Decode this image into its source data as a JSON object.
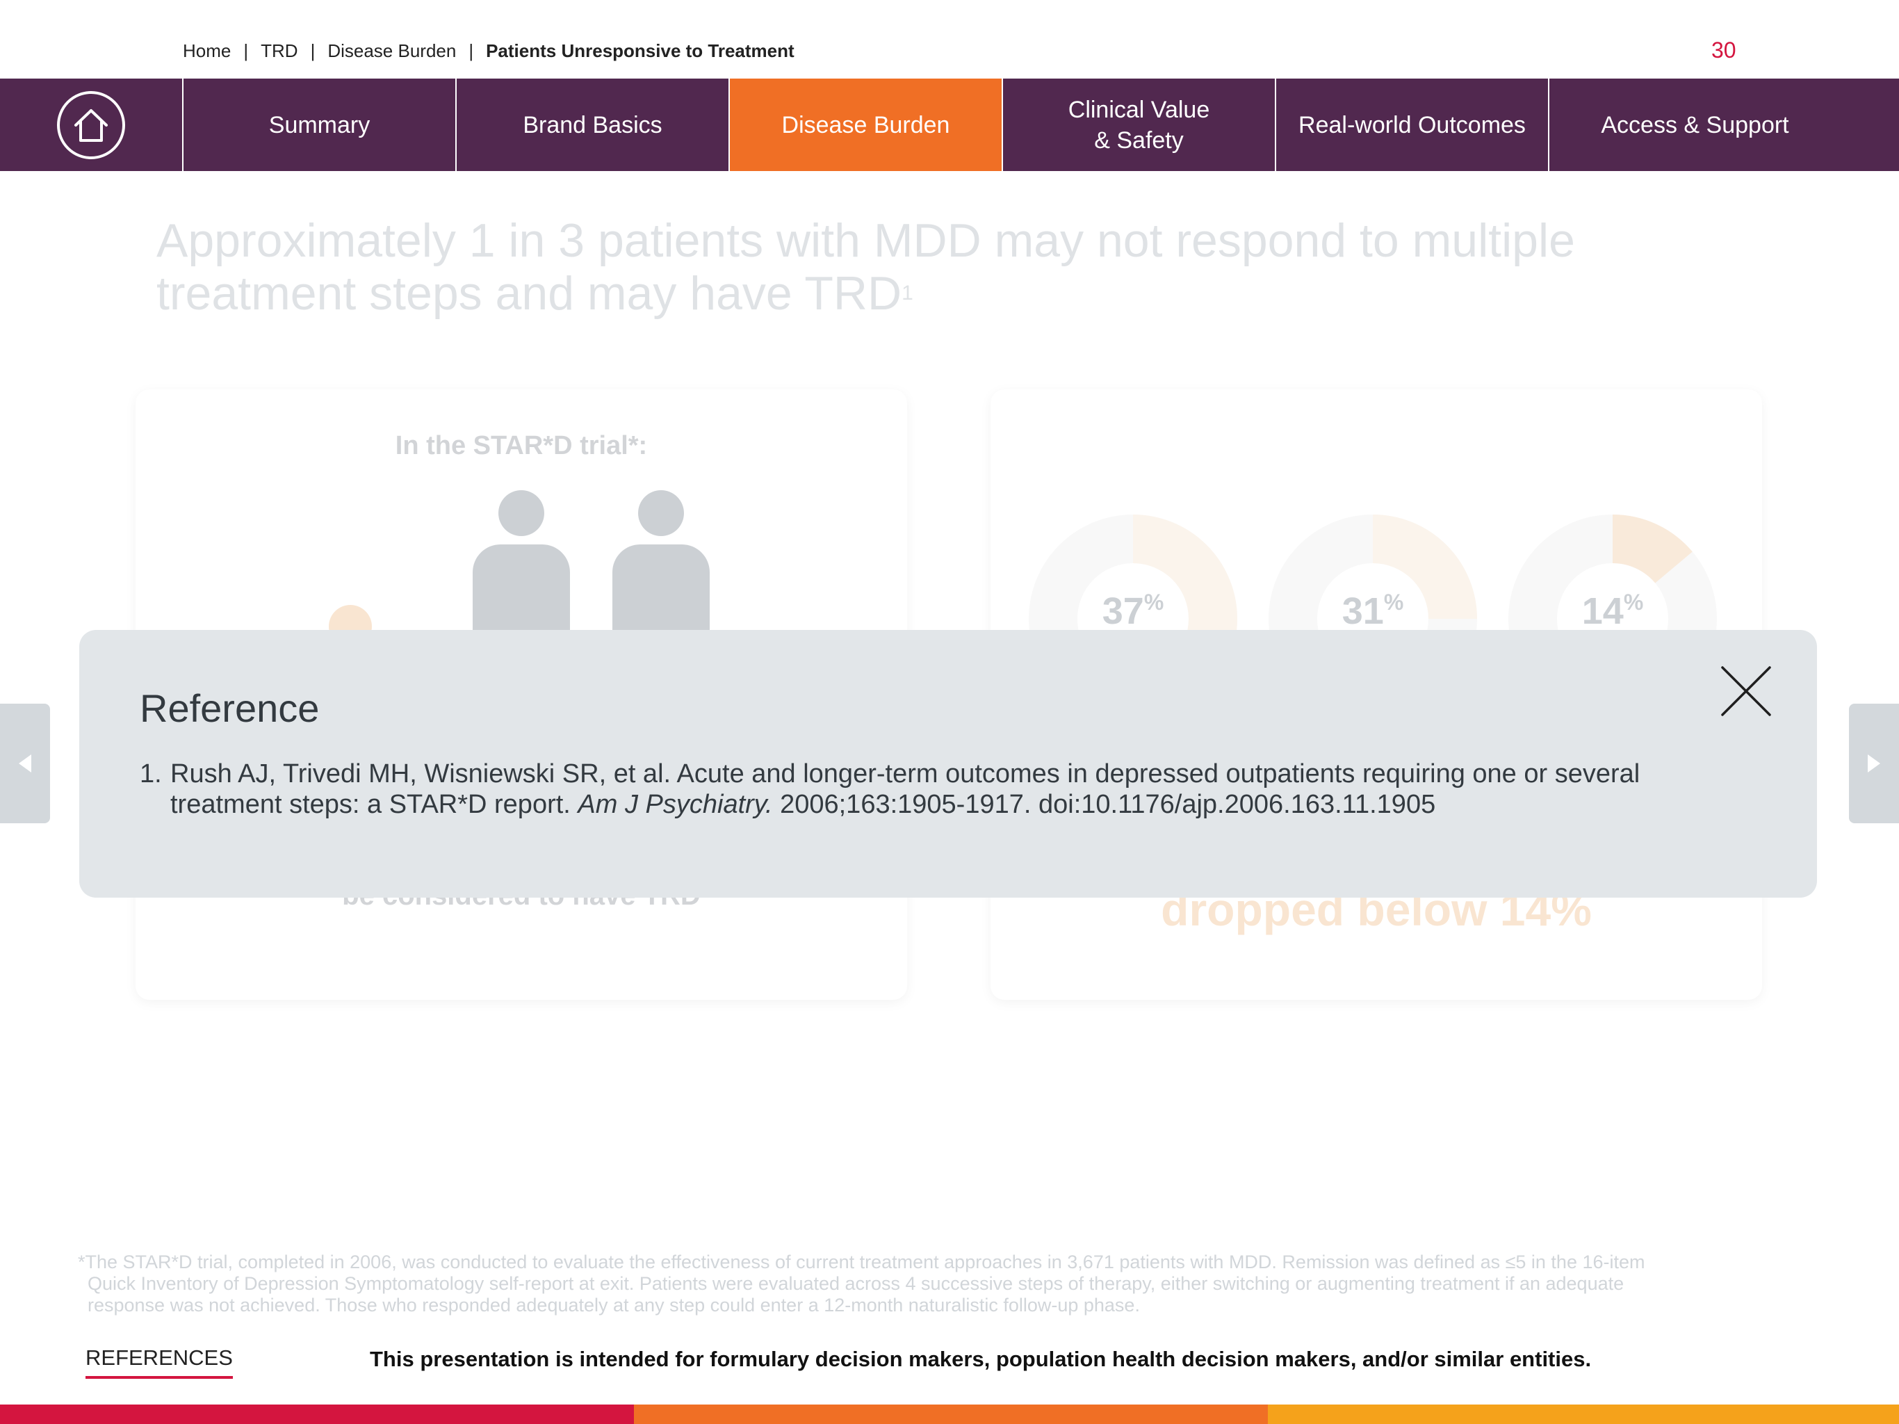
{
  "breadcrumb": {
    "items": [
      "Home",
      "TRD",
      "Disease Burden"
    ],
    "separator": "|",
    "current": "Patients Unresponsive to Treatment"
  },
  "page_number": "30",
  "nav": {
    "home_icon": "home-icon",
    "tabs": [
      {
        "label": "Summary",
        "active": false
      },
      {
        "label": "Brand Basics",
        "active": false
      },
      {
        "label": "Disease Burden",
        "active": true
      },
      {
        "label": "Clinical Value\n& Safety",
        "active": false
      },
      {
        "label": "Real-world Outcomes",
        "active": false
      },
      {
        "label": "Access & Support",
        "active": false
      }
    ]
  },
  "background": {
    "headline": "Approximately 1 in 3 patients with MDD may not respond to multiple treatment steps and may have TRD",
    "headline_ref": "1",
    "left_card": {
      "title": "In the STAR*D trial*:",
      "note": "be considered to have TRD"
    },
    "right_card": {
      "donuts": [
        {
          "value": "37",
          "unit": "%"
        },
        {
          "value": "31",
          "unit": "%"
        },
        {
          "value": "14",
          "unit": "%"
        }
      ],
      "note": "dropped below 14%"
    }
  },
  "modal": {
    "title": "Reference",
    "close_icon": "close-icon",
    "references": [
      {
        "number": "1.",
        "text_before": "Rush AJ, Trivedi MH, Wisniewski SR, et al. Acute and longer-term outcomes in depressed outpatients requiring one or several treatment steps: a STAR*D report. ",
        "journal": "Am J Psychiatry.",
        "text_after": " 2006;163:1905-1917. doi:10.1176/ajp.2006.163.11.1905"
      }
    ]
  },
  "arrows": {
    "left": "chevron-left-icon",
    "right": "chevron-right-icon"
  },
  "footnote": {
    "line1": "*The STAR*D trial, completed in 2006, was conducted to evaluate the effectiveness of current treatment approaches in 3,671 patients with MDD. Remission was defined as ≤5 in the 16-item",
    "line2": "Quick Inventory of Depression Symptomatology self-report at exit. Patients were evaluated across 4 successive steps of therapy, either switching or augmenting treatment if an adequate",
    "line3": "response was not achieved. Those who responded adequately at any step could enter a 12-month naturalistic follow-up phase."
  },
  "footer": {
    "references_label": "REFERENCES",
    "disclaimer": "This presentation is intended for formulary decision makers, population health decision makers, and/or similar entities."
  },
  "colors": {
    "nav_bg": "#51284f",
    "nav_active": "#f06f25",
    "accent_red": "#d4153f",
    "bar_segments": [
      "#d4153f",
      "#f06f25",
      "#f5a21b"
    ]
  }
}
